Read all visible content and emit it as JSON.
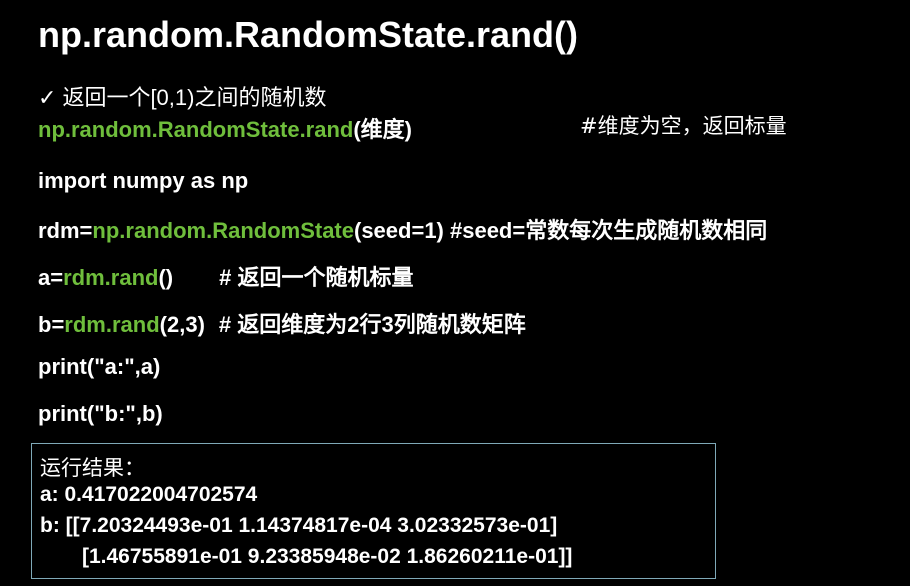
{
  "title": "np.random.RandomState.rand()",
  "desc": {
    "check_mark": "✓",
    "text": "返回一个[0,1)之间的随机数"
  },
  "signature": {
    "func": "np.random.RandomState.rand",
    "args": "(维度)",
    "comment": "#维度为空，返回标量"
  },
  "code": {
    "line1": "import numpy as np",
    "line2_prefix": "rdm=",
    "line2_func": "np.random.RandomState",
    "line2_args": "(seed=1) #seed=常数每次生成随机数相同",
    "line3_prefix": "a=",
    "line3_func": "rdm.rand",
    "line3_args": "()",
    "line3_comment": "# 返回一个随机标量",
    "line4_prefix": "b=",
    "line4_func": "rdm.rand",
    "line4_args": "(2,3)",
    "line4_comment": "# 返回维度为2行3列随机数矩阵",
    "line5": "print(\"a:\",a)",
    "line6": "print(\"b:\",b)"
  },
  "result": {
    "heading": "运行结果：",
    "a_line": "a: 0.417022004702574",
    "b_line1": "b: [[7.20324493e-01 1.14374817e-04 3.02332573e-01]",
    "b_line2": "[1.46755891e-01 9.23385948e-02 1.86260211e-01]]"
  },
  "colors": {
    "background": "#000000",
    "text": "#ffffff",
    "accent_green": "#6fbe3c",
    "box_border": "#7fa9b8"
  }
}
